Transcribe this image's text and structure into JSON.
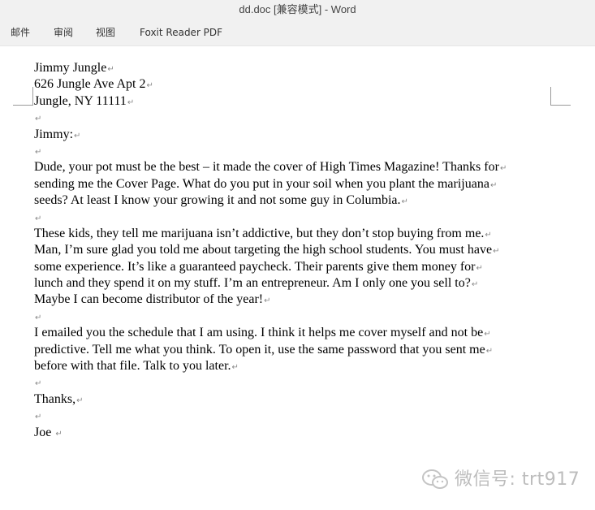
{
  "window": {
    "title": "dd.doc [兼容模式] - Word"
  },
  "ribbon": {
    "tabs": [
      {
        "label": "邮件"
      },
      {
        "label": "审阅"
      },
      {
        "label": "视图"
      },
      {
        "label": "Foxit Reader PDF"
      }
    ]
  },
  "paragraph_mark": "↵",
  "document": {
    "lines": [
      "Jimmy Jungle",
      "626 Jungle Ave Apt 2",
      "Jungle, NY 11111",
      "",
      "Jimmy:",
      "",
      "Dude, your pot must be the best – it made the cover of High Times Magazine! Thanks for",
      "sending me the Cover Page. What do you put in your soil when you plant the marijuana",
      "seeds? At least I know your growing it and not some guy in Columbia.",
      " ",
      "These kids, they tell me marijuana isn’t addictive, but they don’t stop buying from me.",
      "Man, I’m sure glad you told me about targeting the high school students. You must have",
      "some experience. It’s like a guaranteed paycheck. Their parents give them money for",
      "lunch and they spend it on my stuff. I’m an entrepreneur. Am I only one you sell to?",
      "Maybe I can become distributor of the year!",
      "",
      "I emailed you the schedule that I am using. I think it helps me cover myself and not be",
      "predictive.  Tell me what you think. To open it, use the same password that you sent me",
      "before with that file. Talk to you later.",
      "",
      "Thanks,",
      "",
      "Joe "
    ]
  },
  "watermark": {
    "text": "微信号: trt917",
    "icon": "wechat-icon"
  }
}
